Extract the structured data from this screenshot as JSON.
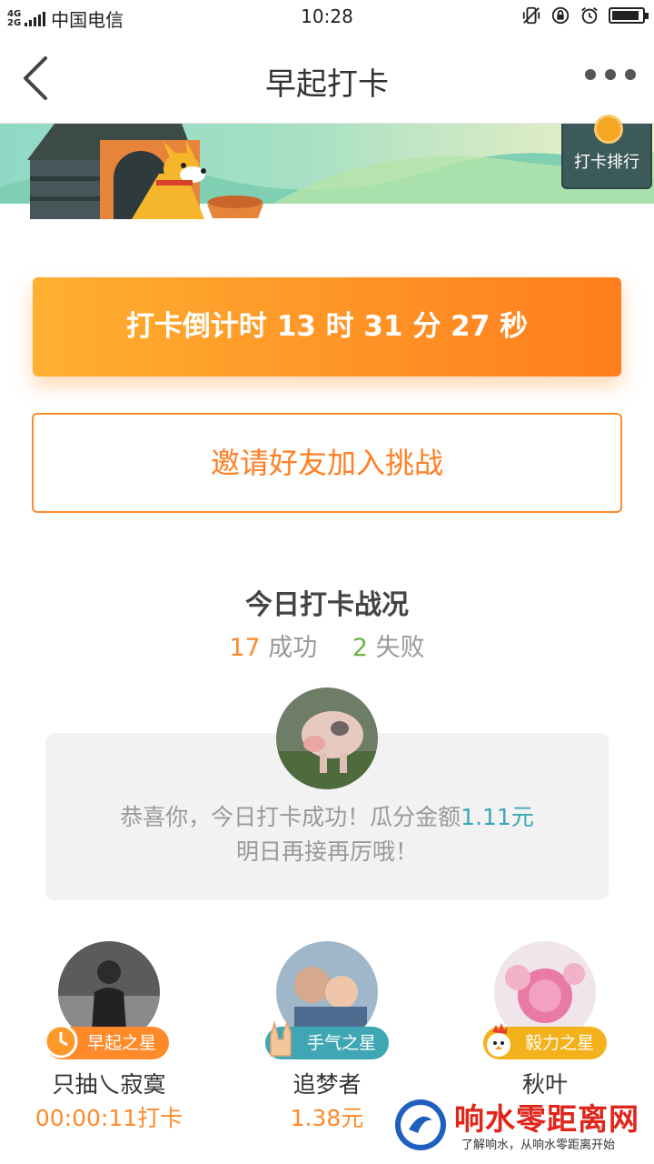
{
  "status_bar": {
    "network_top": "4G",
    "network_bottom": "2G",
    "carrier": "中国电信",
    "time": "10:28",
    "battery_level": 0.9
  },
  "nav": {
    "title": "早起打卡"
  },
  "banner": {
    "rank_label": "打卡排行"
  },
  "countdown": {
    "label": "打卡倒计时  13 时 31 分 27 秒"
  },
  "invite": {
    "label": "邀请好友加入挑战"
  },
  "today": {
    "title": "今日打卡战况",
    "success_count": "17",
    "success_label": "成功",
    "fail_count": "2",
    "fail_label": "失败"
  },
  "message": {
    "line1_prefix": "恭喜你，今日打卡成功！瓜分金额",
    "amount": "1.11元",
    "line2": "明日再接再厉哦！"
  },
  "stars": [
    {
      "badge": "早起之星",
      "name": "只抽乀寂寞",
      "value": "00:00:11打卡",
      "badge_color": "#ff8a2a"
    },
    {
      "badge": "手气之星",
      "name": "追梦者",
      "value": "1.38元",
      "badge_color": "#3fa7b3"
    },
    {
      "badge": "毅力之星",
      "name": "秋叶",
      "value": "",
      "badge_color": "#f3b21b"
    }
  ],
  "watermark": {
    "title": "响水零距离网",
    "subtitle": "了解响水，从响水零距离开始"
  }
}
